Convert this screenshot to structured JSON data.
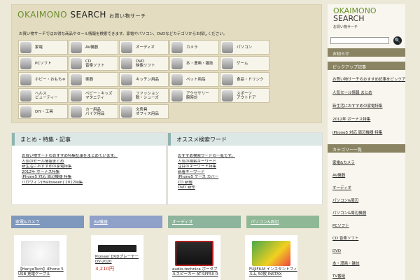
{
  "site": {
    "logo": "OKAIMONO",
    "logo2": "SEARCH",
    "logo_jp": "お買い物サーチ",
    "intro": "お買い物サーチではお得な商品やセール情報を検索できます。家電やパソコン、DVDなどカテゴリからお探しください。"
  },
  "categories": [
    {
      "label1": "家電",
      "label2": "",
      "icon": "tv-icon"
    },
    {
      "label1": "AV機器",
      "label2": "",
      "icon": "av-device-icon"
    },
    {
      "label1": "オーディオ",
      "label2": "",
      "icon": "speaker-icon"
    },
    {
      "label1": "カメラ",
      "label2": "",
      "icon": "camera-icon"
    },
    {
      "label1": "パソコン",
      "label2": "",
      "icon": "laptop-icon"
    },
    {
      "label1": "PCソフト",
      "label2": "",
      "icon": "software-icon"
    },
    {
      "label1": "CD",
      "label2": "音楽ソフト",
      "icon": "cd-icon"
    },
    {
      "label1": "DVD",
      "label2": "映像ソフト",
      "icon": "dvd-icon"
    },
    {
      "label1": "本・漫画・雑誌",
      "label2": "",
      "icon": "book-icon"
    },
    {
      "label1": "ゲーム",
      "label2": "",
      "icon": "gamepad-icon"
    },
    {
      "label1": "ホビー・おもちゃ",
      "label2": "",
      "icon": "toy-icon"
    },
    {
      "label1": "楽器",
      "label2": "",
      "icon": "instrument-icon"
    },
    {
      "label1": "キッチン用品",
      "label2": "",
      "icon": "kitchen-icon"
    },
    {
      "label1": "ペット用品",
      "label2": "",
      "icon": "pet-icon"
    },
    {
      "label1": "食品・ドリンク",
      "label2": "",
      "icon": "food-icon"
    },
    {
      "label1": "ヘルス",
      "label2": "ビューティー",
      "icon": "health-icon"
    },
    {
      "label1": "ベビー・キッズ",
      "label2": "マタニティ",
      "icon": "baby-icon"
    },
    {
      "label1": "ファッション",
      "label2": "靴・シューズ",
      "icon": "fashion-icon"
    },
    {
      "label1": "アクセサリー",
      "label2": "腕時計",
      "icon": "watch-icon"
    },
    {
      "label1": "スポーツ",
      "label2": "アウトドア",
      "icon": "ball-icon"
    },
    {
      "label1": "DIY・工具",
      "label2": "",
      "icon": "tool-icon"
    },
    {
      "label1": "カー用品",
      "label2": "バイク用品",
      "icon": "car-icon"
    },
    {
      "label1": "文房具",
      "label2": "オフィス用品",
      "icon": "stationery-icon"
    }
  ],
  "features": {
    "title": "まとめ・特集・記事",
    "links": [
      "お買い物サーチのおすすめ特集記事をまとめています。",
      "人気のセール情報まとめ",
      "新生活におすすめの家電特集",
      "2012年 ボーナス特集",
      "iPhone5 対応 周辺機器 特集",
      "ハロウィン(Halloween) 2012特集"
    ]
  },
  "keywords": {
    "title": "オススメ検索ワード",
    "links": [
      "おすすめ検索ワードの一覧です。",
      "人気の検索キーワード",
      "注目のキーワード特集",
      "新着キーワード",
      "iPhone5 ケース カバー",
      "CD 新譜",
      "DVD 新作"
    ]
  },
  "tabs": [
    {
      "label": "家電&カメラ",
      "color": "#7f98bd"
    },
    {
      "label": "AV機器",
      "color": "#8fa0c9"
    },
    {
      "label": "オーディオ",
      "color": "#8db49c"
    },
    {
      "label": "パソコン&周辺",
      "color": "#8fb896"
    }
  ],
  "products": [
    {
      "name": "【HanyeTech】iPhone 5 USB 充電ケーブル",
      "price": ""
    },
    {
      "name": "Pioneer DVDプレーヤー DV-2020",
      "price": "3,210円"
    },
    {
      "name": "audio-technica ポータブルスピーカー AT-SPP50 R",
      "price": ""
    },
    {
      "name": "FUJIFILM インスタントフィルム 50枚 INSTAX",
      "price": ""
    }
  ],
  "sidebar": {
    "logo": "OKAIMONO",
    "logo2": "SEARCH",
    "logo_jp": "お買い物サーチ",
    "search_button": "🔍",
    "head1": "お知らせ",
    "head2": "ピックアップ記事",
    "list2": [
      "お買い物サーチのおすすめ記事をピックアップしています。",
      "人気セール情報 まとめ",
      "新生活におすすめの家電特集",
      "2012年 ボーナス特集",
      "iPhone5 対応 周辺機器 特集"
    ],
    "head3": "カテゴリー一覧",
    "list3": [
      "家電&カメラ",
      "AV機器",
      "オーディオ",
      "パソコン&周辺",
      "パソコン&周辺機器",
      "PCソフト",
      "CD 音楽ソフト",
      "DVD",
      "本・漫画・雑誌",
      "TV番組"
    ]
  }
}
